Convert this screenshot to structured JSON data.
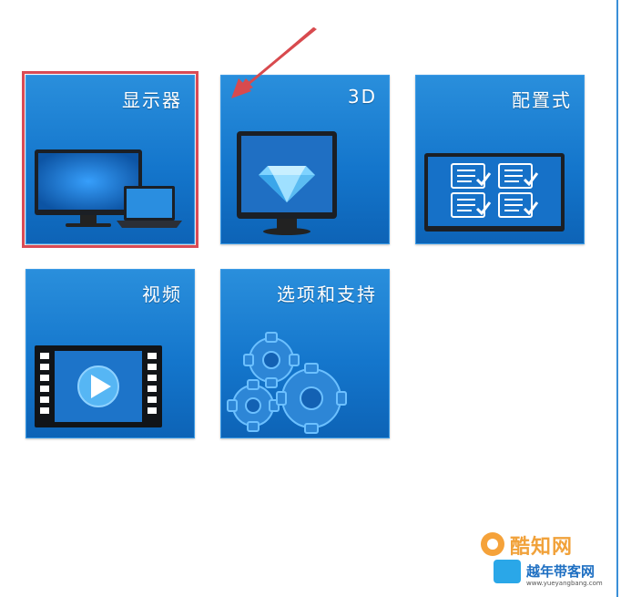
{
  "tiles": {
    "display": {
      "label": "显示器"
    },
    "threed": {
      "label": "3D"
    },
    "config": {
      "label": "配置式"
    },
    "video": {
      "label": "视频"
    },
    "options": {
      "label": "选项和支持"
    }
  },
  "selected_tile": "display",
  "watermarks": {
    "top": "酷知网",
    "bottom": "越年带客网",
    "url": "www.yueyangbang.com"
  },
  "colors": {
    "tile_bg": "#1476cc",
    "selection_border": "#d94b55",
    "arrow": "#d84a4e"
  },
  "icons": {
    "display": "monitor-and-laptop-icon",
    "threed": "monitor-with-diamond-icon",
    "config": "monitor-with-checklists-icon",
    "video": "filmstrip-play-icon",
    "options": "gears-icon"
  }
}
